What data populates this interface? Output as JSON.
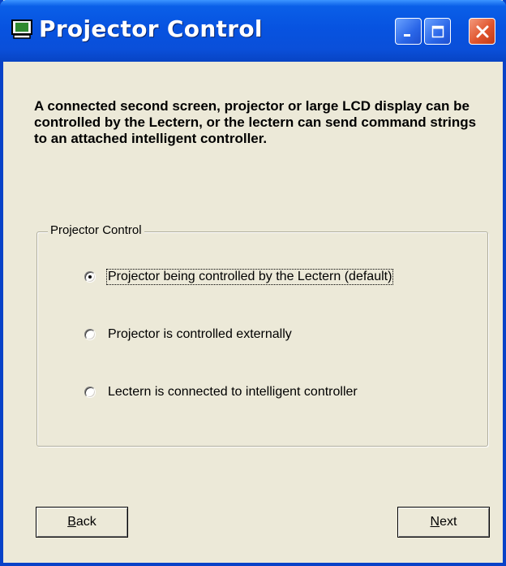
{
  "window": {
    "title": "Projector Control",
    "icon": "monitor-icon",
    "controls": [
      "minimize-icon",
      "maximize-icon",
      "close-icon"
    ]
  },
  "description": "A connected second screen, projector or large LCD display can be controlled by the Lectern, or the lectern can send command strings to an attached intelligent controller.",
  "group": {
    "title": "Projector Control",
    "options": [
      {
        "label": "Projector being controlled by the Lectern (default)",
        "checked": true
      },
      {
        "label": "Projector is controlled externally",
        "checked": false
      },
      {
        "label": "Lectern is connected to intelligent controller",
        "checked": false
      }
    ]
  },
  "buttons": {
    "back_mnemonic": "B",
    "back_rest": "ack",
    "next_mnemonic": "N",
    "next_rest": "ext"
  },
  "colors": {
    "titlebar": "#0753E0",
    "window_bg": "#ECE9D8",
    "close_button": "#E0552E"
  }
}
